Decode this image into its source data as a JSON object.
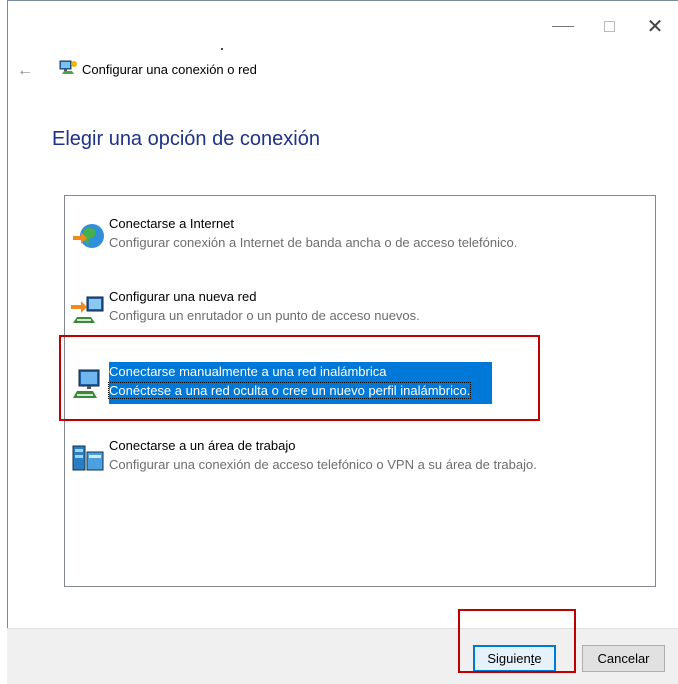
{
  "window": {
    "title": "Configurar una conexión o red",
    "controls": {
      "minimize": "—",
      "close": "✕"
    }
  },
  "page": {
    "heading": "Elegir una opción de conexión"
  },
  "options": [
    {
      "title": "Conectarse a Internet",
      "description": "Configurar conexión a Internet de banda ancha o de acceso telefónico.",
      "icon": "globe-icon"
    },
    {
      "title": "Configurar una nueva red",
      "description": "Configura un enrutador o un punto de acceso nuevos.",
      "icon": "router-icon"
    },
    {
      "title": "Conectarse manualmente a una red inalámbrica",
      "description": "Conéctese a una red oculta o cree un nuevo perfil inalámbrico.",
      "icon": "wireless-computer-icon",
      "selected": true
    },
    {
      "title": "Conectarse a un área de trabajo",
      "description": "Configurar una conexión de acceso telefónico o VPN a su área de trabajo.",
      "icon": "workplace-icon"
    }
  ],
  "footer": {
    "next_label_pre": "Siguien",
    "next_label_u": "t",
    "next_label_post": "e",
    "cancel_label": "Cancelar"
  },
  "colors": {
    "accent": "#0078d7",
    "heading": "#1e3287",
    "highlight_box": "#c00000"
  }
}
